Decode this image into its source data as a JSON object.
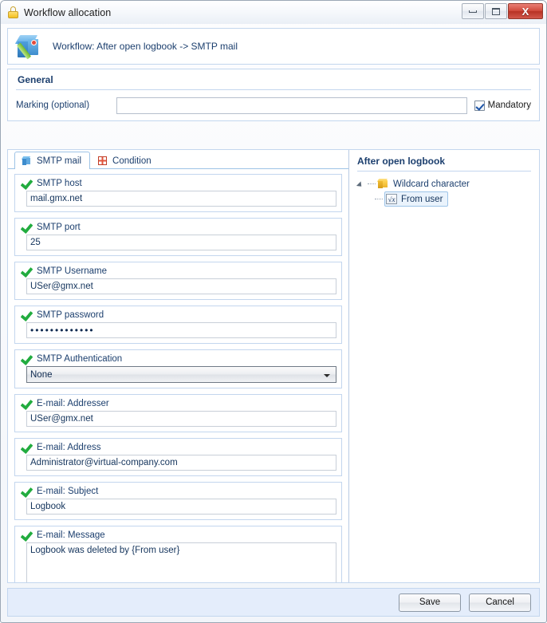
{
  "window": {
    "title": "Workflow allocation",
    "lock_icon": "lock-icon",
    "controls": {
      "minimize": "minimize-icon",
      "restore": "restore-icon",
      "close": "X"
    }
  },
  "banner": {
    "icon": "workflow-cube-pencil-icon",
    "text": "Workflow: After open logbook -> SMTP mail"
  },
  "general": {
    "title": "General",
    "marking_label": "Marking (optional)",
    "marking_value": "",
    "marking_placeholder": "",
    "mandatory_label": "Mandatory",
    "mandatory_checked": true
  },
  "tabs": [
    {
      "label": "SMTP mail",
      "icon": "cube-icon",
      "active": true
    },
    {
      "label": "Condition",
      "icon": "condition-icon",
      "active": false
    }
  ],
  "fields": [
    {
      "label": "SMTP host",
      "value": "mail.gmx.net",
      "type": "text",
      "valid_icon": "green-check-icon"
    },
    {
      "label": "SMTP port",
      "value": "25",
      "type": "text",
      "valid_icon": "green-check-icon"
    },
    {
      "label": "SMTP Username",
      "value": "USer@gmx.net",
      "type": "text",
      "valid_icon": "green-check-icon"
    },
    {
      "label": "SMTP password",
      "value": "•••••••••••••",
      "type": "password",
      "valid_icon": "green-check-icon"
    },
    {
      "label": "SMTP Authentication",
      "value": "None",
      "type": "select",
      "valid_icon": "green-check-icon"
    },
    {
      "label": "E-mail: Addresser",
      "value": "USer@gmx.net",
      "type": "text",
      "valid_icon": "green-check-icon"
    },
    {
      "label": "E-mail: Address",
      "value": "Administrator@virtual-company.com",
      "type": "text",
      "valid_icon": "green-check-icon"
    },
    {
      "label": "E-mail: Subject",
      "value": "Logbook",
      "type": "text",
      "valid_icon": "green-check-icon"
    },
    {
      "label": "E-mail: Message",
      "value": "Logbook was deleted by {From user}",
      "type": "textarea",
      "valid_icon": "green-check-icon"
    }
  ],
  "tree": {
    "title": "After open logbook",
    "root": {
      "label": "Wildcard character",
      "icon": "folder-cube-icon",
      "expander": "expanded-arrow-icon"
    },
    "child": {
      "label": "From user",
      "icon": "fx-icon",
      "icon_text": "√x",
      "selected": true
    }
  },
  "footer": {
    "save_label": "Save",
    "cancel_label": "Cancel"
  },
  "colors": {
    "accent_blue": "#1c3f6e",
    "panel_border": "#c3d6ee",
    "footer_bg": "#e4edfb",
    "check_green": "#22ac3f",
    "close_red": "#b83224"
  }
}
